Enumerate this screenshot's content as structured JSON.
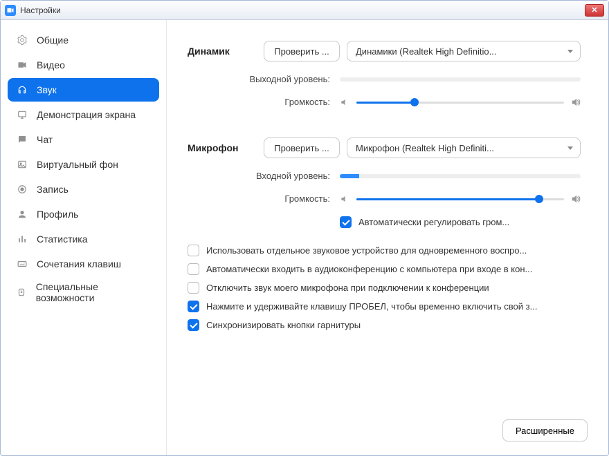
{
  "window": {
    "title": "Настройки"
  },
  "sidebar": {
    "items": [
      {
        "label": "Общие"
      },
      {
        "label": "Видео"
      },
      {
        "label": "Звук"
      },
      {
        "label": "Демонстрация экрана"
      },
      {
        "label": "Чат"
      },
      {
        "label": "Виртуальный фон"
      },
      {
        "label": "Запись"
      },
      {
        "label": "Профиль"
      },
      {
        "label": "Статистика"
      },
      {
        "label": "Сочетания клавиш"
      },
      {
        "label": "Специальные возможности"
      }
    ]
  },
  "speaker": {
    "heading": "Динамик",
    "test_btn": "Проверить ...",
    "device": "Динамики (Realtek High Definitio...",
    "output_level_label": "Выходной уровень:",
    "volume_label": "Громкость:",
    "volume_percent": 28
  },
  "mic": {
    "heading": "Микрофон",
    "test_btn": "Проверить ...",
    "device": "Микрофон (Realtek High Definiti...",
    "input_level_label": "Входной уровень:",
    "input_level_percent": 8,
    "volume_label": "Громкость:",
    "volume_percent": 88,
    "auto_adjust_label": "Автоматически регулировать гром..."
  },
  "options": {
    "separate_device": "Использовать отдельное звуковое устройство для одновременного воспро...",
    "auto_join_audio": "Автоматически входить в аудиоконференцию с компьютера при входе в кон...",
    "mute_on_join": "Отключить звук моего микрофона при подключении к конференции",
    "ptt_space": "Нажмите и удерживайте клавишу ПРОБЕЛ, чтобы временно включить свой з...",
    "sync_headset": "Синхронизировать кнопки гарнитуры"
  },
  "advanced_btn": "Расширенные"
}
